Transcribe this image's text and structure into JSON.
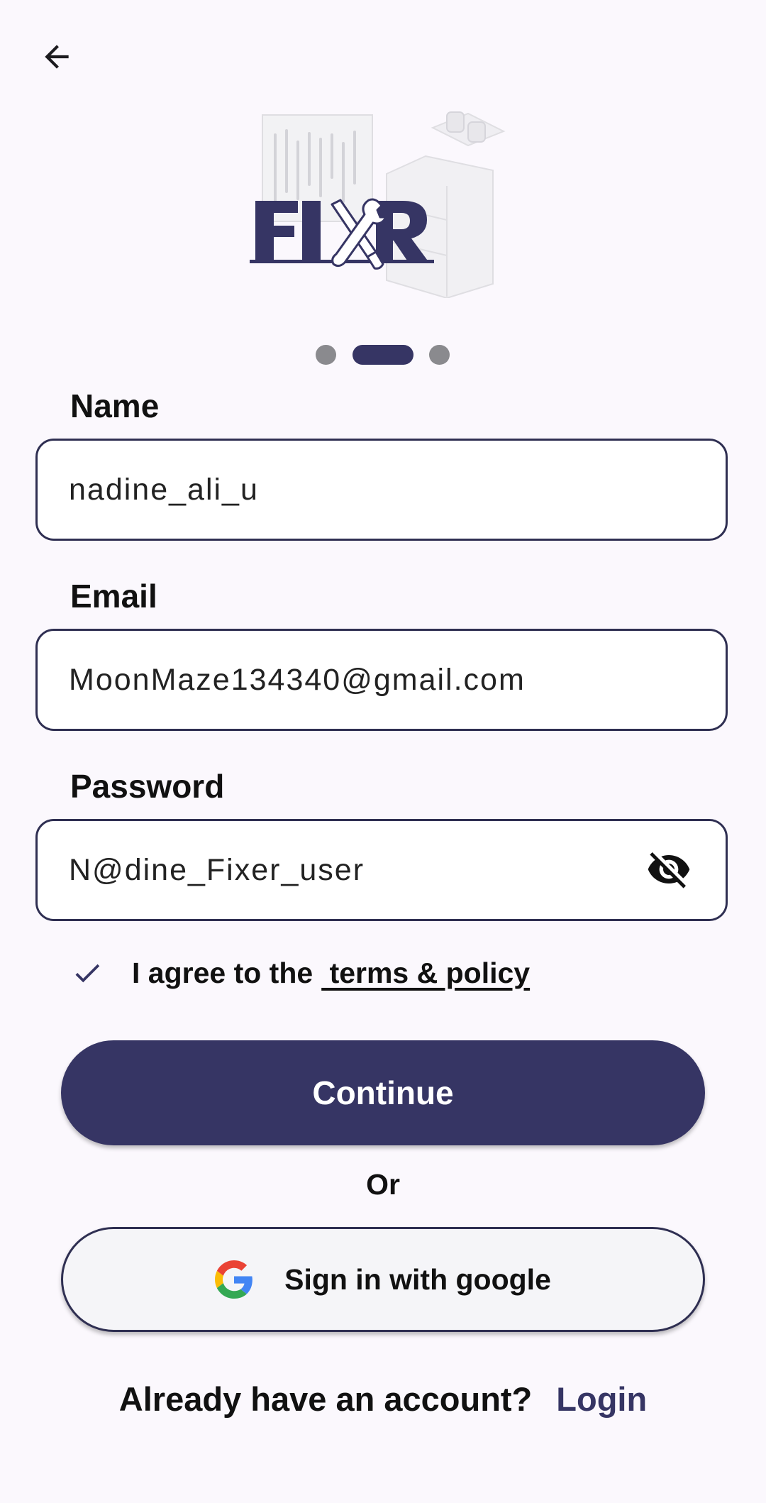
{
  "header": {
    "back_icon": "arrow-left-icon"
  },
  "logo": {
    "text": "FIXR",
    "icon": "crossed-screwdriver-wrench-icon"
  },
  "pager": {
    "total": 3,
    "active_index": 1
  },
  "form": {
    "name": {
      "label": "Name",
      "value": "nadine_ali_u"
    },
    "email": {
      "label": "Email",
      "value": "MoonMaze134340@gmail.com"
    },
    "password": {
      "label": "Password",
      "value": "N@dine_Fixer_user",
      "toggle_icon": "eye-off-icon"
    },
    "agree": {
      "checked": true,
      "text": "I agree to the",
      "link": " terms & policy"
    }
  },
  "actions": {
    "continue_label": "Continue",
    "or_label": "Or",
    "google_label": "Sign in with google",
    "google_icon": "google-icon"
  },
  "footer": {
    "prompt": "Already have an account?",
    "login_label": "Login"
  },
  "colors": {
    "primary": "#363564",
    "background": "#fbf8fd",
    "dot_inactive": "#8a8a8e"
  }
}
